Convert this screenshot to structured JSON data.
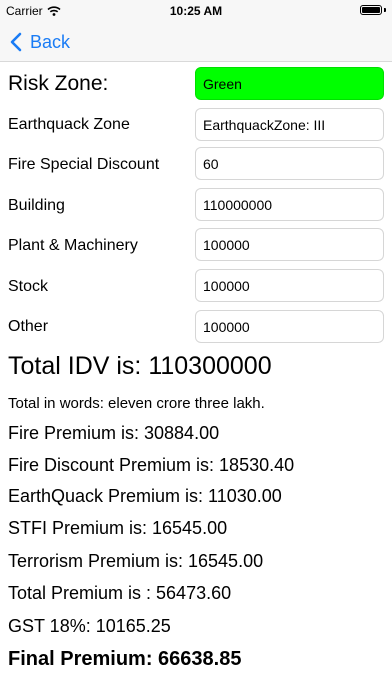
{
  "status_bar": {
    "carrier": "Carrier",
    "time": "10:25 AM",
    "wifi_icon": "wifi-icon",
    "battery_icon": "battery-icon"
  },
  "nav": {
    "back_label": "Back",
    "back_icon": "chevron-left-icon",
    "accent_color": "#1a7cf5"
  },
  "form": {
    "risk_zone": {
      "label": "Risk Zone:",
      "value": "Green",
      "value_bg": "#00ff00"
    },
    "earthquake_zone": {
      "label": "Earthquack Zone",
      "value": "EarthquackZone: III"
    },
    "fire_special_discount": {
      "label": "Fire Special Discount",
      "value": "60"
    },
    "building": {
      "label": "Building",
      "value": "110000000"
    },
    "plant_machinery": {
      "label": "Plant & Machinery",
      "value": "100000"
    },
    "stock": {
      "label": "Stock",
      "value": "100000"
    },
    "other": {
      "label": "Other",
      "value": "100000"
    }
  },
  "summary": {
    "total_idv": "Total IDV is: 110300000",
    "total_in_words": "Total in words: eleven crore three lakh.",
    "fire_premium": "Fire Premium is: 30884.00",
    "fire_discount_premium": "Fire Discount Premium is: 18530.40",
    "earthquake_premium": "EarthQuack Premium is: 11030.00",
    "stfi_premium": "STFI Premium is: 16545.00",
    "terrorism_premium": "Terrorism Premium is: 16545.00",
    "total_premium": "Total Premium is : 56473.60",
    "gst": "GST 18%: 10165.25",
    "final_premium": "Final Premium: 66638.85"
  }
}
